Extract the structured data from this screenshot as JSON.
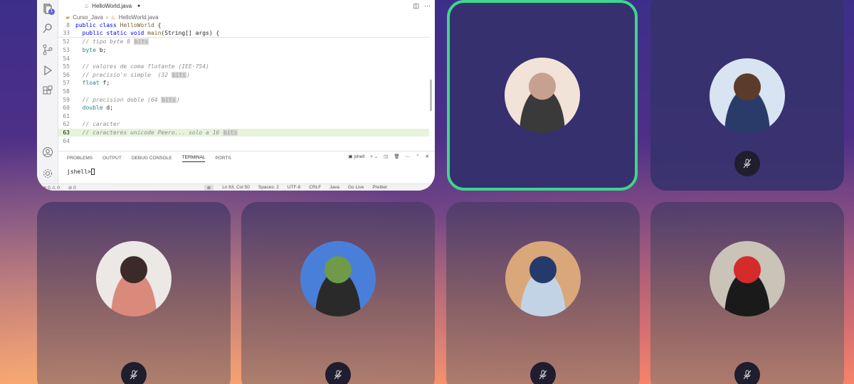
{
  "editor": {
    "tab_title": "HelloWorld.java",
    "breadcrumb": [
      "Curso_Java",
      "HelloWorld.java"
    ],
    "sticky_lines": [
      {
        "n": "8",
        "code": [
          [
            "kw",
            "public class "
          ],
          [
            "fn",
            "HelloWorld"
          ],
          [
            "tx",
            " {"
          ]
        ]
      },
      {
        "n": "33",
        "code": [
          [
            "kw",
            "  public static void "
          ],
          [
            "fn",
            "main"
          ],
          [
            "tx",
            "(String[] args) {"
          ]
        ]
      }
    ],
    "lines": [
      {
        "n": "52",
        "code": [
          [
            "cm",
            "  // tipo byte 8 "
          ],
          [
            "bits",
            "bits"
          ]
        ]
      },
      {
        "n": "53",
        "code": [
          [
            "ty",
            "  byte"
          ],
          [
            "tx",
            " b;"
          ]
        ]
      },
      {
        "n": "54",
        "code": []
      },
      {
        "n": "55",
        "code": [
          [
            "cm",
            "  // valores de coma flotante (IEE-754)"
          ]
        ]
      },
      {
        "n": "56",
        "code": [
          [
            "cm",
            "  // precisio'n simple  (32 "
          ],
          [
            "bits",
            "bits"
          ],
          [
            "cm",
            ")"
          ]
        ]
      },
      {
        "n": "57",
        "code": [
          [
            "ty",
            "  float"
          ],
          [
            "tx",
            " f;"
          ]
        ]
      },
      {
        "n": "58",
        "code": []
      },
      {
        "n": "59",
        "code": [
          [
            "cm",
            "  // precision doble (64 "
          ],
          [
            "bits",
            "bits"
          ],
          [
            "cm",
            ")"
          ]
        ]
      },
      {
        "n": "60",
        "code": [
          [
            "ty",
            "  double"
          ],
          [
            "tx",
            " d;"
          ]
        ]
      },
      {
        "n": "61",
        "code": []
      },
      {
        "n": "62",
        "code": [
          [
            "cm",
            "  // caracter"
          ]
        ]
      },
      {
        "n": "63",
        "code": [
          [
            "cm",
            "  // caracteres unicode Peero... solo a 16 "
          ],
          [
            "bits",
            "bits"
          ]
        ],
        "current": true
      },
      {
        "n": "64",
        "code": []
      }
    ],
    "panel_tabs": [
      "PROBLEMS",
      "OUTPUT",
      "DEBUG CONSOLE",
      "TERMINAL",
      "PORTS"
    ],
    "active_panel_tab": "TERMINAL",
    "terminal_name": "jshell",
    "terminal_prompt": "jshell>",
    "status_left": [
      "⊗ 0 ⚠ 0",
      "⊘ 0"
    ],
    "status_right": [
      "Ln 63, Col 50",
      "Spaces: 2",
      "UTF-8",
      "CRLF",
      "Java",
      "Go Live",
      "Prettier"
    ],
    "badge_count": "1"
  },
  "participants": [
    {
      "id": "p1",
      "colors": [
        "#f2e3d8",
        "#c7a18f",
        "#3a3a3a"
      ],
      "muted": false,
      "active": true
    },
    {
      "id": "p2",
      "colors": [
        "#d9e4f2",
        "#5b3b2a",
        "#2a3b6a"
      ],
      "muted": true
    },
    {
      "id": "p3",
      "colors": [
        "#ece8e6",
        "#3b2a28",
        "#d98a7a"
      ],
      "muted": true
    },
    {
      "id": "p4",
      "colors": [
        "#4a7fd9",
        "#6e9a4a",
        "#2a2a2a"
      ],
      "muted": true
    },
    {
      "id": "p5",
      "colors": [
        "#d9a77a",
        "#243a6a",
        "#c2d3e6"
      ],
      "muted": true
    },
    {
      "id": "p6",
      "colors": [
        "#c9c3b8",
        "#d42b2b",
        "#1a1a1a"
      ],
      "muted": true
    }
  ],
  "colors": {
    "active_border": "#3ed68c",
    "mic_bg": "#1f1d2e"
  }
}
